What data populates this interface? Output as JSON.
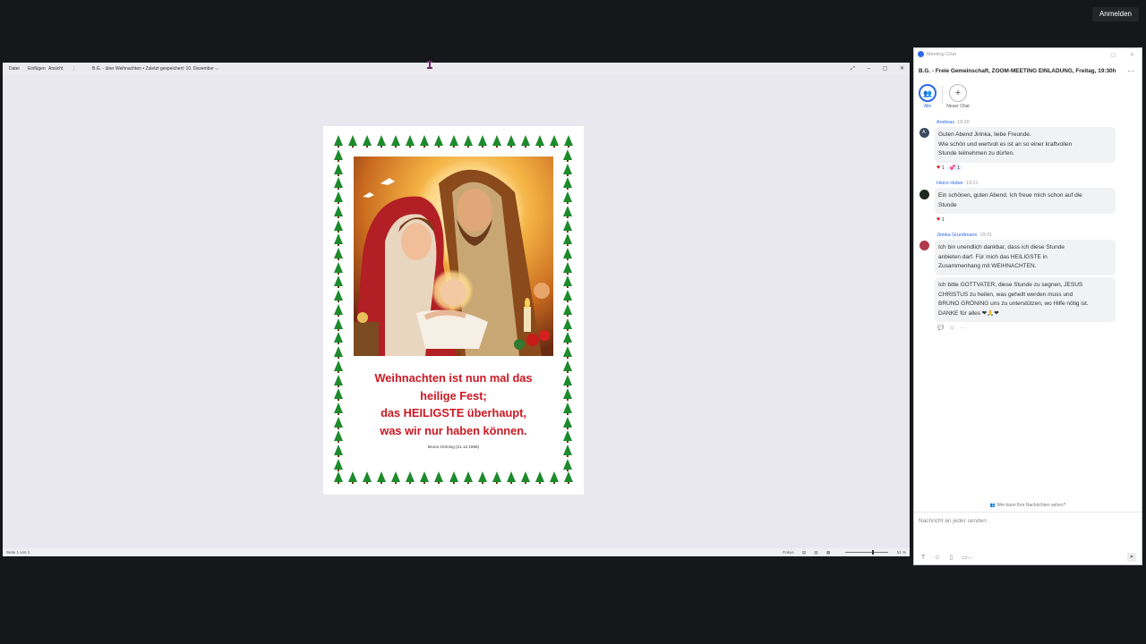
{
  "top": {
    "signin_label": "Anmelden"
  },
  "viewer": {
    "menu": [
      "Datei",
      "Einfügen",
      "Ansicht",
      "⋮"
    ],
    "doc_title": "B.G. - über Weihnachten • Zuletzt gespeichert: 10. Dezember ⌵",
    "window_controls": [
      "⤢",
      "–",
      "▢",
      "✕"
    ],
    "status_left": "Seite 1 von 1",
    "status_focus": "Fokus",
    "zoom": "51 %",
    "page": {
      "quote_lines": [
        "Weihnachten ist nun mal das",
        "heilige Fest;",
        "das HEILIGSTE überhaupt,",
        "was wir nur haben können."
      ],
      "author": "Bruno Gröning (21.12.1956)",
      "accent_color": "#cc1722",
      "tree_color": "#1d8a2c"
    }
  },
  "chat": {
    "window_title": "Meeting-Chat",
    "meeting_name": "B.G. - Freie Gemeinschaft, ZOOM-MEETING EINLADUNG, Freitag, 19:30h",
    "tabs": {
      "all": "Alle",
      "new": "Neuer Chat"
    },
    "messages": [
      {
        "sender": "Andreas",
        "time": "19:20",
        "avatar": "A.",
        "lines": [
          "Guten Abend Jirinka, liebe Freunde.",
          "Wie schön und wertvoll es ist an so einer kraftvollen",
          "Stunde teilnehmen zu dürfen."
        ],
        "reaction_heart_count": "1",
        "reaction_second_count": "1"
      },
      {
        "sender": "Heinz Huber",
        "time": "19:21",
        "lines": [
          "Ein schönen, guten Abend. Ich freue mich schon auf die",
          "Stunde"
        ],
        "reaction_heart_count": "1"
      },
      {
        "sender": "Jirinka Grundmann",
        "time": "19:21",
        "lines": [
          "Ich bin unendlich dankbar, dass ich diese Stunde",
          "anbieten darf. Für mich das HEILIGSTE in",
          "Zusammenhang mit WEIHNACHTEN."
        ],
        "lines2": [
          "Ich bitte GOTTVATER, diese Stunde zu segnen, JESUS",
          "CHRISTUS zu heilen, was geheilt werden muss und",
          "BRUNO GRÖNING uns zu unterstützen, wo Hilfe nötig ist.",
          "DANKE für alles ❤🙏❤"
        ]
      }
    ],
    "who_sees": "Wer kann Ihre Nachrichten sehen?",
    "compose_placeholder": "Nachricht an jeder senden",
    "accent": "#2d69e8"
  }
}
